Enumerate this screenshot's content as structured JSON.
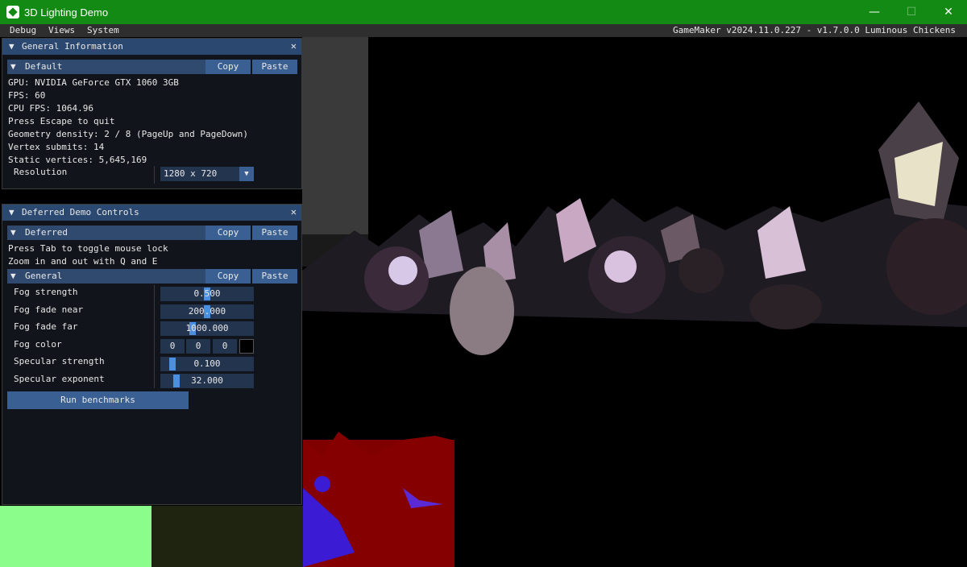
{
  "window": {
    "title": "3D Lighting Demo",
    "minimize": "—",
    "maximize": "☐",
    "close": "✕"
  },
  "menu": {
    "items": [
      "Debug",
      "Views",
      "System"
    ],
    "version": "GameMaker v2024.11.0.227  - v1.7.0.0 Luminous Chickens"
  },
  "general_panel": {
    "title": "General Information",
    "section": "Default",
    "copy": "Copy",
    "paste": "Paste",
    "lines": [
      "GPU: NVIDIA GeForce GTX 1060 3GB",
      "FPS: 60",
      "CPU FPS: 1064.96",
      "Press Escape to quit",
      "Geometry density: 2 / 8 (PageUp and PageDown)",
      "Vertex submits: 14",
      "Static vertices: 5,645,169"
    ],
    "resolution_label": "Resolution",
    "resolution_value": "1280 x 720"
  },
  "deferred_panel": {
    "title": "Deferred Demo Controls",
    "section": "Deferred",
    "copy": "Copy",
    "paste": "Paste",
    "lines": [
      "Press Tab to toggle mouse lock",
      "Zoom in and out with Q and E"
    ],
    "general_section": "General",
    "controls": [
      {
        "label": "Fog strength",
        "value": "0.500",
        "fraction": 0.5
      },
      {
        "label": "Fog fade near",
        "value": "200.000",
        "fraction": 0.5
      },
      {
        "label": "Fog fade far",
        "value": "1000.000",
        "fraction": 0.33
      },
      {
        "label": "Fog color",
        "rgb": [
          "0",
          "0",
          "0"
        ],
        "swatch": "#000000"
      },
      {
        "label": "Specular strength",
        "value": "0.100",
        "fraction": 0.1
      },
      {
        "label": "Specular exponent",
        "value": "32.000",
        "fraction": 0.15
      }
    ],
    "run_button": "Run benchmarks"
  },
  "colors": {
    "titlebar": "#138a13",
    "header": "#2f4a6e",
    "button": "#3a5f92",
    "slider_grab": "#4a8fe0"
  }
}
